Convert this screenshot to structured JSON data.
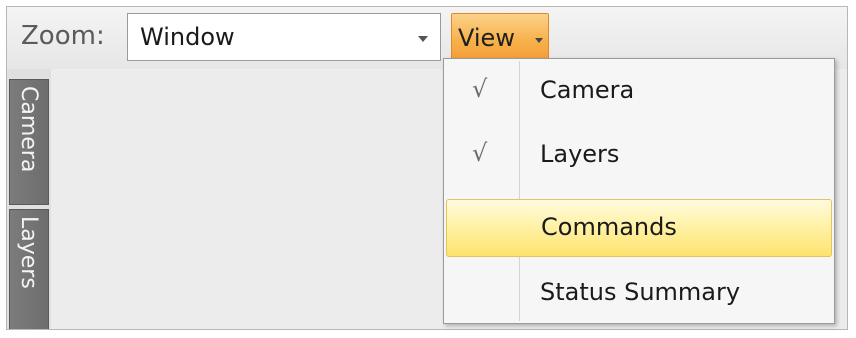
{
  "toolbar": {
    "zoom_label": "Zoom:",
    "zoom_value": "Window",
    "view_label": "View"
  },
  "side_tabs": [
    {
      "label": "Camera"
    },
    {
      "label": "Layers"
    }
  ],
  "view_menu": {
    "items": [
      {
        "label": "Camera",
        "checked": true,
        "check_glyph": "√"
      },
      {
        "label": "Layers",
        "checked": true,
        "check_glyph": "√"
      },
      {
        "label": "Commands",
        "checked": false,
        "highlighted": true
      },
      {
        "label": "Status Summary",
        "checked": false
      }
    ]
  },
  "colors": {
    "view_button_accent": "#f7b14c",
    "highlight": "#fde36e",
    "side_tab": "#747474"
  }
}
